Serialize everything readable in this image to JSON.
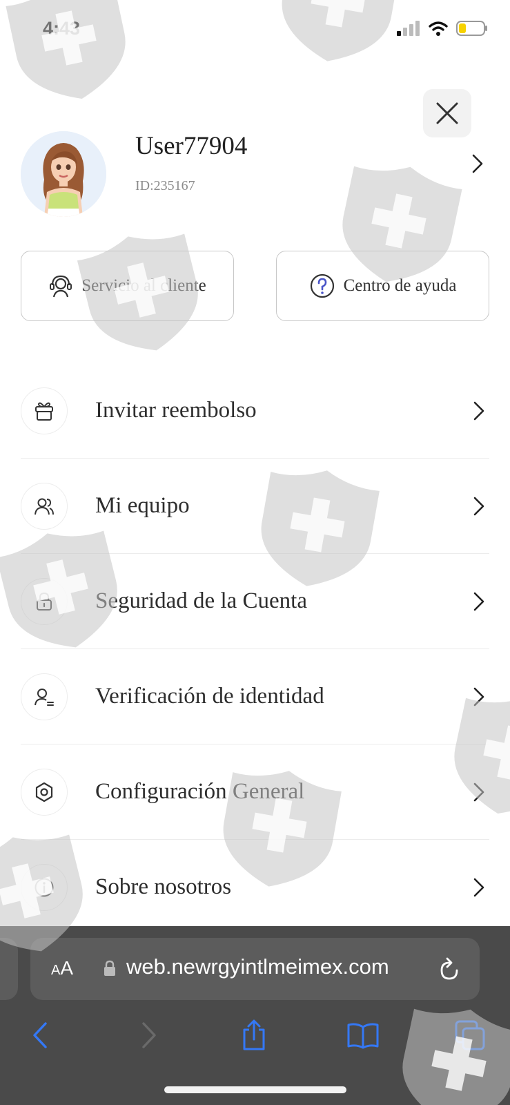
{
  "status": {
    "time": "4:43"
  },
  "profile": {
    "username": "User77904",
    "id": "ID:235167"
  },
  "buttons": {
    "service": "Servicio al cliente",
    "help": "Centro de ayuda"
  },
  "menu": {
    "items": [
      {
        "label": "Invitar reembolso",
        "icon": "gift-icon"
      },
      {
        "label": "Mi equipo",
        "icon": "team-icon"
      },
      {
        "label": "Seguridad de la Cuenta",
        "icon": "lock-icon"
      },
      {
        "label": "Verificación de identidad",
        "icon": "user-id-icon"
      },
      {
        "label": "Configuración General",
        "icon": "settings-icon"
      },
      {
        "label": "Sobre nosotros",
        "icon": "info-icon"
      }
    ]
  },
  "browser": {
    "text_size_small": "A",
    "text_size_large": "A",
    "url": "web.newrgyintlmeimex.com"
  },
  "colors": {
    "accent": "#3478f6",
    "toolbar": "#4a4a4a",
    "watermark": "#d0d0d0"
  }
}
